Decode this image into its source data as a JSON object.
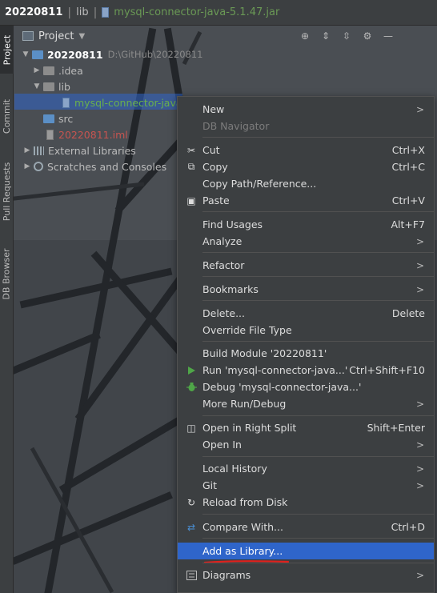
{
  "breadcrumb": {
    "project": "20220811",
    "folder": "lib",
    "file": "mysql-connector-java-5.1.47.jar"
  },
  "tool_stripe": {
    "tabs": [
      "Project",
      "Commit",
      "Pull Requests",
      "DB Browser"
    ]
  },
  "project_panel": {
    "title": "Project",
    "tree": {
      "root": "20220811",
      "root_path": "D:\\GitHub\\20220811",
      "idea": ".idea",
      "lib": "lib",
      "jar": "mysql-connector-java",
      "src": "src",
      "iml": "20220811.iml",
      "external_libraries": "External Libraries",
      "scratches": "Scratches and Consoles"
    }
  },
  "context_menu": {
    "new": "New",
    "db_navigator": "DB Navigator",
    "cut": "Cut",
    "cut_sc": "Ctrl+X",
    "copy": "Copy",
    "copy_sc": "Ctrl+C",
    "copy_path": "Copy Path/Reference...",
    "paste": "Paste",
    "paste_sc": "Ctrl+V",
    "find_usages": "Find Usages",
    "find_usages_sc": "Alt+F7",
    "analyze": "Analyze",
    "refactor": "Refactor",
    "bookmarks": "Bookmarks",
    "delete": "Delete...",
    "delete_sc": "Delete",
    "override_type": "Override File Type",
    "build_module": "Build Module '20220811'",
    "run": "Run 'mysql-connector-java...'",
    "run_sc": "Ctrl+Shift+F10",
    "debug": "Debug 'mysql-connector-java...'",
    "more_run": "More Run/Debug",
    "open_right": "Open in Right Split",
    "open_right_sc": "Shift+Enter",
    "open_in": "Open In",
    "local_history": "Local History",
    "git": "Git",
    "reload": "Reload from Disk",
    "compare": "Compare With...",
    "compare_sc": "Ctrl+D",
    "add_library": "Add as Library...",
    "diagrams": "Diagrams"
  },
  "colors": {
    "selection": "#2f65ca",
    "annotation": "#e0201c",
    "run_green": "#4fa648"
  }
}
